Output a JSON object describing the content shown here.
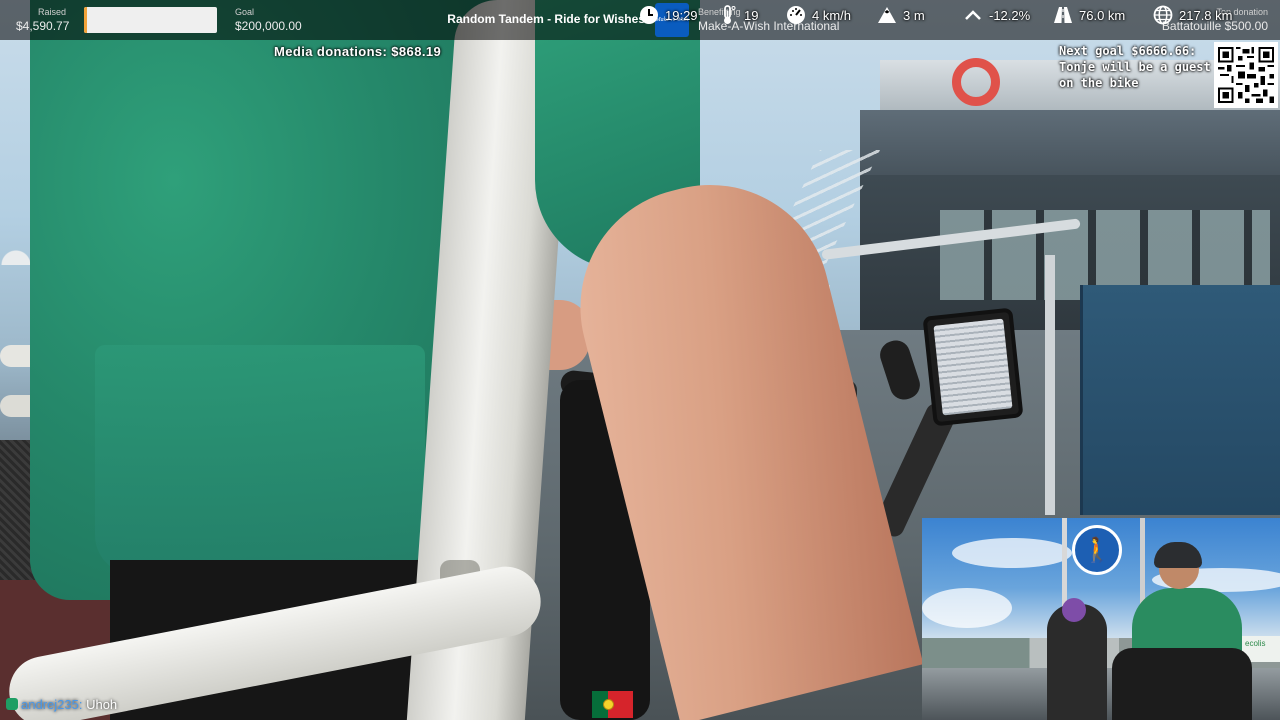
{
  "topbar": {
    "raised_label": "Raised",
    "raised_value": "$4,590.77",
    "progress_fraction": 0.023,
    "goal_label": "Goal",
    "goal_value": "$200,000.00",
    "stream_title": "Random Tandem - Ride for Wishes",
    "charity_logo_text": "Make-A-Wish",
    "benefitting_label": "Benefitting",
    "charity_name": "Make-A-Wish International",
    "top_donation_label": "Top donation",
    "top_donation_value": "Battatouille $500.00",
    "colors": {
      "progress_fill": "#f2a33a",
      "charity_blue": "#0a5cbf"
    }
  },
  "overlay": {
    "media_donations": "Media donations: $868.19",
    "next_goal_line1": "Next goal $6666.66:",
    "next_goal_line2": "Tonje will be a guest",
    "next_goal_line3": "on the bike",
    "qr_icon": "qr-code-icon"
  },
  "pip": {
    "sign_icon": "pedestrian-sign-icon",
    "banner_text": "ecolis"
  },
  "chat": {
    "username": "andrej235:",
    "message": "Uhoh"
  },
  "stats": {
    "country_flag": "portugal-flag",
    "time": "19:29",
    "temperature": "19",
    "speed": "4 km/h",
    "altitude": "3 m",
    "grade": "-12.2%",
    "distance_today": "76.0 km",
    "distance_total": "217.8 km"
  }
}
